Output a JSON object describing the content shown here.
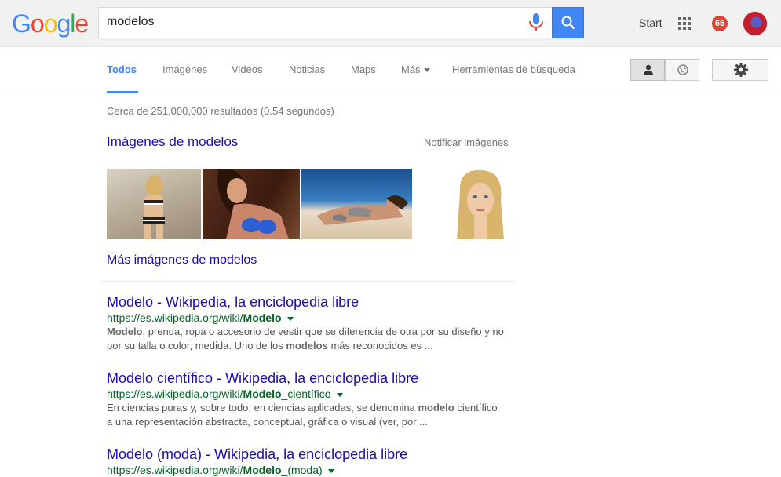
{
  "logo": {
    "letters": [
      "G",
      "o",
      "o",
      "g",
      "l",
      "e"
    ],
    "colors": [
      "#4285f4",
      "#ea4335",
      "#fbbc05",
      "#4285f4",
      "#34a853",
      "#ea4335"
    ]
  },
  "search": {
    "query": "modelos"
  },
  "header": {
    "start": "Start",
    "notifications": "65"
  },
  "tabs": [
    {
      "label": "Todos",
      "active": true
    },
    {
      "label": "Imágenes"
    },
    {
      "label": "Videos"
    },
    {
      "label": "Noticias"
    },
    {
      "label": "Maps"
    },
    {
      "label": "Más"
    },
    {
      "label": "Herramientas de búsqueda"
    }
  ],
  "stats": "Cerca de 251,000,000 resultados (0.54 segundos)",
  "images_block": {
    "heading": "Imágenes de modelos",
    "notify": "Notificar imágenes",
    "more": "Más imágenes de modelos"
  },
  "results": [
    {
      "title": "Modelo - Wikipedia, la enciclopedia libre",
      "url_prefix": "https://es.wikipedia.org/wiki/",
      "url_bold": "Modelo",
      "url_suffix": "",
      "snippet_line1_bold": "Modelo",
      "snippet_line1": ", prenda, ropa o accesorio de vestir que se diferencia de otra por su diseño y no",
      "snippet_line2_a": "por su talla o color, medida. Uno de los ",
      "snippet_line2_bold": "modelos",
      "snippet_line2_b": " más reconocidos es ..."
    },
    {
      "title": "Modelo científico - Wikipedia, la enciclopedia libre",
      "url_prefix": "https://es.wikipedia.org/wiki/",
      "url_bold": "Modelo",
      "url_suffix": "_científico",
      "snippet_line1_a": "En ciencias puras y, sobre todo, en ciencias aplicadas, se denomina ",
      "snippet_line1_bold": "modelo",
      "snippet_line1_b": " científico",
      "snippet_line2": "a una representación abstracta, conceptual, gráfica o visual (ver, por ..."
    },
    {
      "title": "Modelo (moda) - Wikipedia, la enciclopedia libre",
      "url_prefix": "https://es.wikipedia.org/wiki/",
      "url_bold": "Modelo",
      "url_suffix": "_(moda)"
    }
  ]
}
